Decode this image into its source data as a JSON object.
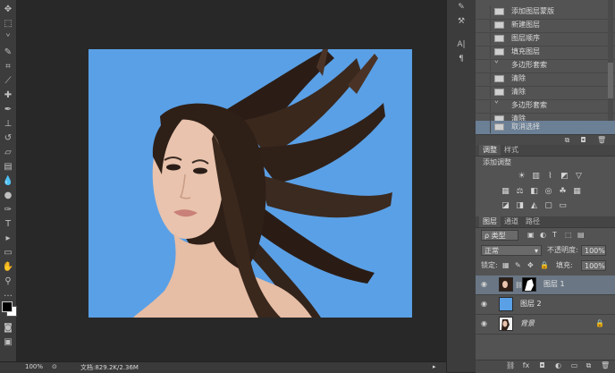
{
  "canvas": {
    "zoom": "100%",
    "doc_info": "文档:829.2K/2.36M",
    "background_color": "#5aa0e6"
  },
  "history": {
    "items": [
      {
        "label": "添加图层蒙版"
      },
      {
        "label": "新建图层"
      },
      {
        "label": "图层顺序"
      },
      {
        "label": "填充图层"
      },
      {
        "label": "多边形套索"
      },
      {
        "label": "清除"
      },
      {
        "label": "清除"
      },
      {
        "label": "多边形套索"
      },
      {
        "label": "清除"
      },
      {
        "label": "取消选择"
      }
    ],
    "active_index": 9
  },
  "adjustments": {
    "tabs": [
      {
        "label": "调整"
      },
      {
        "label": "样式"
      }
    ],
    "title": "添加调整"
  },
  "layers": {
    "tabs": [
      {
        "label": "图层"
      },
      {
        "label": "通道"
      },
      {
        "label": "路径"
      }
    ],
    "filter": "ρ 类型",
    "blend_mode": "正常",
    "opacity_label": "不透明度:",
    "opacity_value": "100%",
    "lock_label": "锁定:",
    "fill_label": "填充:",
    "fill_value": "100%",
    "items": [
      {
        "name": "图层 1"
      },
      {
        "name": "图层 2"
      },
      {
        "name": "背景"
      }
    ],
    "active_index": 0
  }
}
